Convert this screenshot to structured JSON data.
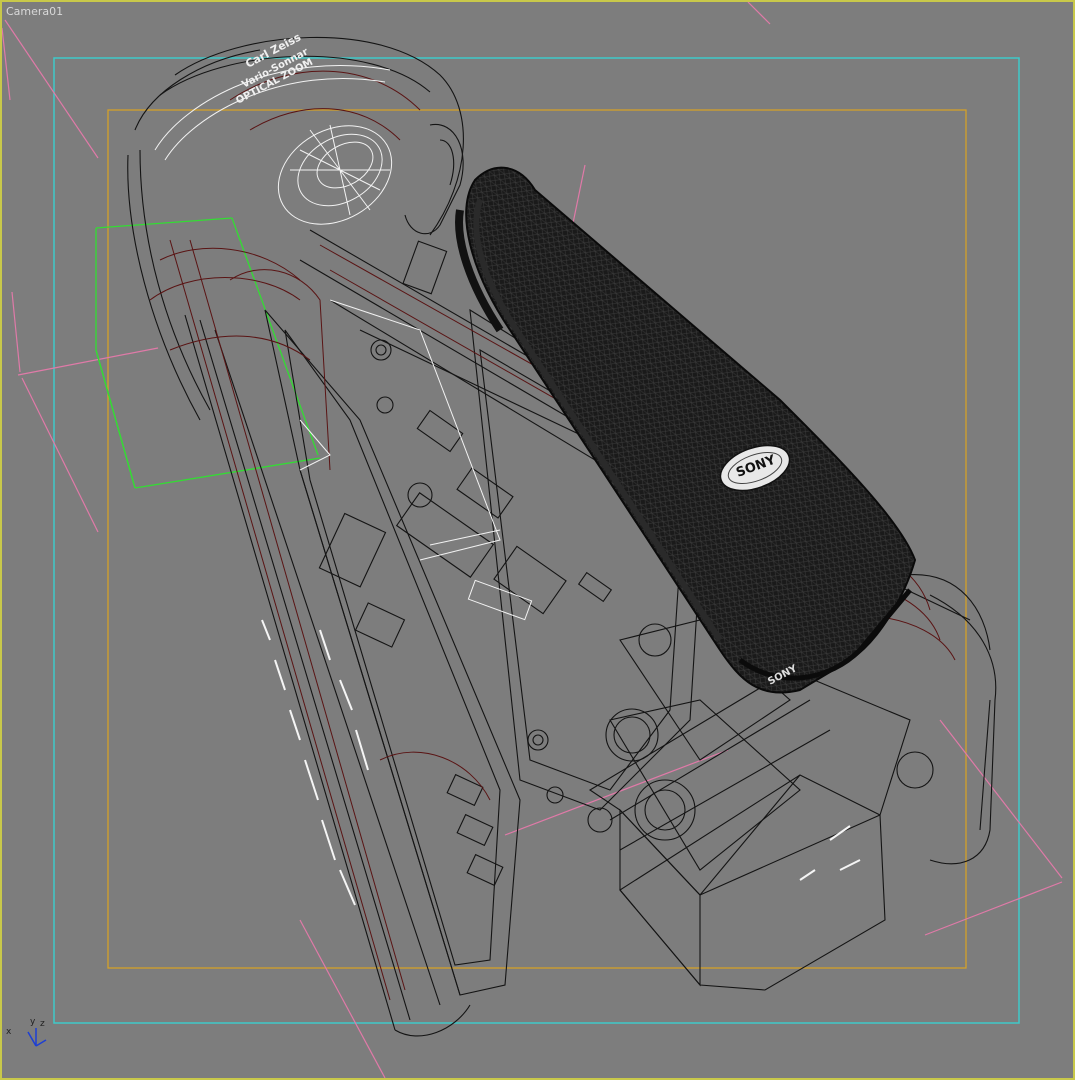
{
  "viewport": {
    "label": "Camera01",
    "colors": {
      "background": "#7d7d7d",
      "border": "#c8c84a",
      "safe_frame_outer": "#3fc9c9",
      "safe_frame_inner": "#d4a12a",
      "camera_guides": "#e07aa8",
      "selection": "#33dd33",
      "wire_black": "#141414",
      "wire_red": "#5a1414",
      "wire_white": "#f2f2f2"
    }
  },
  "axis": {
    "x": "x",
    "y": "y",
    "z": "z"
  },
  "model_text": {
    "lens_line1": "Carl Zeiss",
    "lens_line2": "Vario-Sonnar",
    "lens_line3": "OPTICAL ZOOM",
    "grip_badge": "SONY",
    "side_brand": "SONY"
  }
}
